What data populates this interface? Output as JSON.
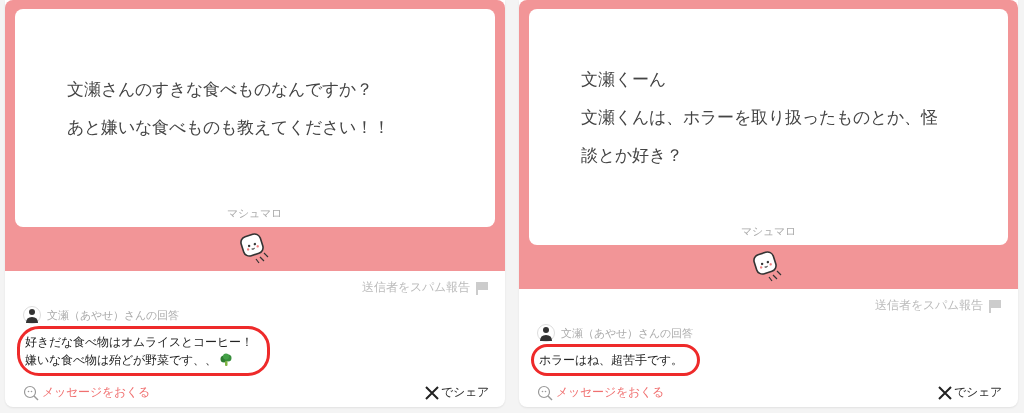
{
  "cards": [
    {
      "question": {
        "lines": [
          "文瀬さんのすきな食べものなんですか？",
          "あと嫌いな食べものも教えてください！！"
        ]
      },
      "brand": "マシュマロ",
      "report": "送信者をスパム報告",
      "answerer": "文瀬（あやせ）さんの回答",
      "answer": {
        "lines": [
          "好きだな食べ物はオムライスとコーヒー！",
          "嫌いな食べ物は殆どが野菜です、、"
        ],
        "broccoli_icon": true,
        "highlighted": true
      },
      "send_message": "メッセージをおくる",
      "share": "でシェア"
    },
    {
      "question": {
        "lines": [
          "文瀬くーん",
          "文瀬くんは、ホラーを取り扱ったものとか、怪",
          "談とか好き？"
        ]
      },
      "brand": "マシュマロ",
      "report": "送信者をスパム報告",
      "answerer": "文瀬（あやせ）さんの回答",
      "answer": {
        "lines": [
          "ホラーはね、超苦手です。"
        ],
        "highlighted": true
      },
      "send_message": "メッセージをおくる",
      "share": "でシェア"
    }
  ]
}
